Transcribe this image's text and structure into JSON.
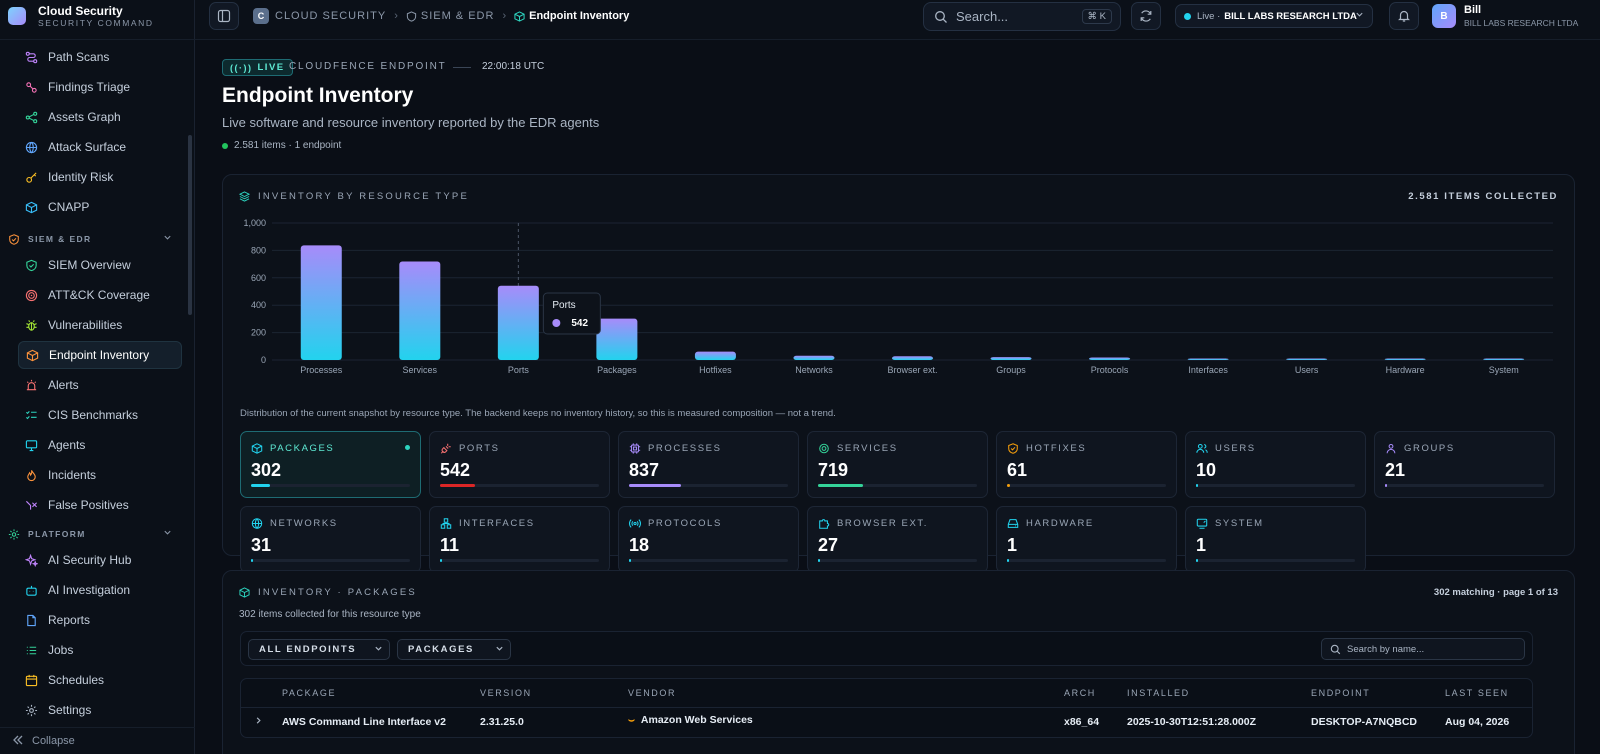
{
  "brand": {
    "title": "Cloud Security",
    "subtitle": "SECURITY COMMAND"
  },
  "sidebar": {
    "items_top": [
      {
        "label": "Path Scans",
        "icon": "route-icon"
      },
      {
        "label": "Findings Triage",
        "icon": "triage-icon"
      },
      {
        "label": "Assets Graph",
        "icon": "share-icon"
      },
      {
        "label": "Attack Surface",
        "icon": "globe-icon"
      },
      {
        "label": "Identity Risk",
        "icon": "key-icon"
      },
      {
        "label": "CNAPP",
        "icon": "cube-icon"
      }
    ],
    "section_siem": "SIEM & EDR",
    "items_siem": [
      {
        "label": "SIEM Overview",
        "icon": "shield-check-icon"
      },
      {
        "label": "ATT&CK Coverage",
        "icon": "target-icon"
      },
      {
        "label": "Vulnerabilities",
        "icon": "bug-icon"
      },
      {
        "label": "Endpoint Inventory",
        "icon": "package-icon",
        "active": true
      },
      {
        "label": "Alerts",
        "icon": "siren-icon"
      },
      {
        "label": "CIS Benchmarks",
        "icon": "list-check-icon"
      },
      {
        "label": "Agents",
        "icon": "monitor-icon"
      },
      {
        "label": "Incidents",
        "icon": "flame-icon"
      },
      {
        "label": "False Positives",
        "icon": "x-filter-icon"
      }
    ],
    "section_platform": "PLATFORM",
    "items_platform": [
      {
        "label": "AI Security Hub",
        "icon": "sparkles-icon"
      },
      {
        "label": "AI Investigation",
        "icon": "bot-icon"
      },
      {
        "label": "Reports",
        "icon": "file-icon"
      },
      {
        "label": "Jobs",
        "icon": "list-icon"
      },
      {
        "label": "Schedules",
        "icon": "calendar-icon"
      },
      {
        "label": "Settings",
        "icon": "gear-icon"
      }
    ],
    "collapse": "Collapse"
  },
  "topbar": {
    "crumb_badge": "C",
    "crumb1": "CLOUD SECURITY",
    "crumb2": "SIEM & EDR",
    "crumb3": "Endpoint Inventory",
    "search_placeholder": "Search...",
    "shortcut": "⌘ K",
    "tenant_status": "Live ·",
    "tenant_name": "BILL LABS RESEARCH LTDA",
    "user_initial": "B",
    "user_name": "Bill",
    "user_org": "BILL LABS RESEARCH LTDA"
  },
  "header": {
    "live": "LIVE",
    "kicker": "CLOUDFENCE ENDPOINT",
    "time": "22:00:18 UTC",
    "title": "Endpoint Inventory",
    "subtitle": "Live software and resource inventory reported by the EDR agents",
    "count_line": "2.581 items · 1 endpoint"
  },
  "chart_panel": {
    "heading": "INVENTORY BY RESOURCE TYPE",
    "total": "2.581 ITEMS COLLECTED",
    "note": "Distribution of the current snapshot by resource type. The backend keeps no inventory history, so this is measured composition — not a trend.",
    "tooltip_title": "Ports",
    "tooltip_value": "542"
  },
  "chart_data": {
    "type": "bar",
    "categories": [
      "Processes",
      "Services",
      "Ports",
      "Packages",
      "Hotfixes",
      "Networks",
      "Browser ext.",
      "Groups",
      "Protocols",
      "Interfaces",
      "Users",
      "Hardware",
      "System"
    ],
    "values": [
      837,
      719,
      542,
      302,
      61,
      31,
      27,
      21,
      18,
      11,
      10,
      1,
      1
    ],
    "ylim": [
      0,
      1000
    ],
    "yticks": [
      "0",
      "200",
      "400",
      "600",
      "800",
      "1,000"
    ],
    "ytick_values": [
      0,
      200,
      400,
      600,
      800,
      1000
    ],
    "grid": true,
    "colors": {
      "top": "#a78bfa",
      "bottom": "#22d3ee"
    },
    "highlight": "Ports"
  },
  "tiles": [
    {
      "label": "PACKAGES",
      "value": "302",
      "frac": 0.12,
      "color": "#22d3ee",
      "icon": "package-icon",
      "active": true
    },
    {
      "label": "PORTS",
      "value": "542",
      "frac": 0.22,
      "color": "#dc2626",
      "icon": "plug-icon"
    },
    {
      "label": "PROCESSES",
      "value": "837",
      "frac": 0.33,
      "color": "#a78bfa",
      "icon": "cpu-icon"
    },
    {
      "label": "SERVICES",
      "value": "719",
      "frac": 0.28,
      "color": "#34d399",
      "icon": "cog-icon"
    },
    {
      "label": "HOTFIXES",
      "value": "61",
      "frac": 0.02,
      "color": "#f59e0b",
      "icon": "shield-icon"
    },
    {
      "label": "USERS",
      "value": "10",
      "frac": 0.004,
      "color": "#22d3ee",
      "icon": "users-icon"
    },
    {
      "label": "GROUPS",
      "value": "21",
      "frac": 0.008,
      "color": "#a78bfa",
      "icon": "group-icon"
    },
    {
      "label": "NETWORKS",
      "value": "31",
      "frac": 0.012,
      "color": "#22d3ee",
      "icon": "globe-icon"
    },
    {
      "label": "INTERFACES",
      "value": "11",
      "frac": 0.004,
      "color": "#22d3ee",
      "icon": "network-icon"
    },
    {
      "label": "PROTOCOLS",
      "value": "18",
      "frac": 0.007,
      "color": "#22d3ee",
      "icon": "radio-icon"
    },
    {
      "label": "BROWSER EXT.",
      "value": "27",
      "frac": 0.01,
      "color": "#22d3ee",
      "icon": "puzzle-icon"
    },
    {
      "label": "HARDWARE",
      "value": "1",
      "frac": 0.001,
      "color": "#22d3ee",
      "icon": "harddrive-icon"
    },
    {
      "label": "SYSTEM",
      "value": "1",
      "frac": 0.001,
      "color": "#22d3ee",
      "icon": "screen-icon"
    }
  ],
  "table_panel": {
    "heading": "INVENTORY · PACKAGES",
    "subtitle": "302 items collected for this resource type",
    "meta": "302 matching · page 1 of 13",
    "filter_endpoints": "ALL ENDPOINTS",
    "filter_type": "PACKAGES",
    "search_placeholder": "Search by name...",
    "columns": [
      "PACKAGE",
      "VERSION",
      "VENDOR",
      "ARCH",
      "INSTALLED",
      "ENDPOINT",
      "LAST SEEN"
    ],
    "rows": [
      {
        "package": "AWS Command Line Interface v2",
        "version": "2.31.25.0",
        "vendor": "Amazon Web Services",
        "arch": "x86_64",
        "installed": "2025-10-30T12:51:28.000Z",
        "endpoint": "DESKTOP-A7NQBCD",
        "last_seen": "Aug 04, 2026"
      }
    ]
  },
  "colors": {
    "accent": "#22d3ee",
    "live": "#5eead4",
    "bg": "#0a0e16"
  }
}
